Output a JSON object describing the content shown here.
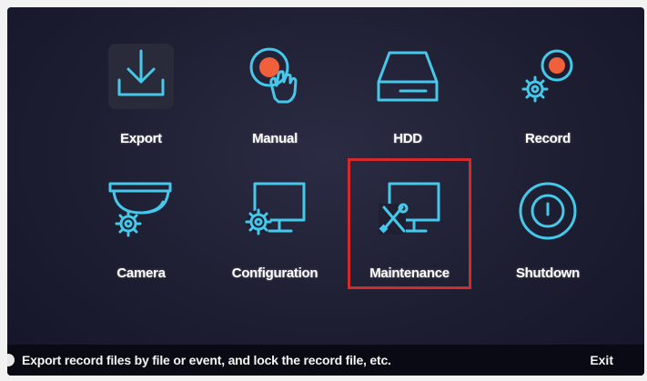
{
  "menu": {
    "items": [
      {
        "label": "Export",
        "icon": "export-icon"
      },
      {
        "label": "Manual",
        "icon": "manual-icon"
      },
      {
        "label": "HDD",
        "icon": "hdd-icon"
      },
      {
        "label": "Record",
        "icon": "record-icon"
      },
      {
        "label": "Camera",
        "icon": "camera-icon"
      },
      {
        "label": "Configuration",
        "icon": "configuration-icon"
      },
      {
        "label": "Maintenance",
        "icon": "maintenance-icon"
      },
      {
        "label": "Shutdown",
        "icon": "shutdown-icon"
      }
    ],
    "selected": "Maintenance"
  },
  "statusbar": {
    "description": "Export record files by file or event, and lock the record file, etc.",
    "exit_label": "Exit"
  },
  "colors": {
    "icon_accent": "#45c8ea",
    "record_dot": "#f0603a",
    "selection_border": "#d42a2a",
    "background": "#1d1e31"
  }
}
